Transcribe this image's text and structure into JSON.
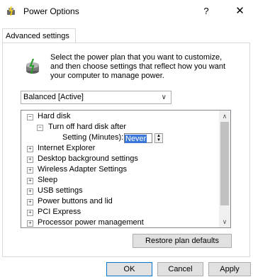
{
  "window": {
    "title": "Power Options",
    "help_label": "?",
    "close_label": "✕"
  },
  "tab": {
    "label": "Advanced settings"
  },
  "intro": {
    "text": "Select the power plan that you want to customize, and then choose settings that reflect how you want your computer to manage power."
  },
  "plan_select": {
    "value": "Balanced [Active]"
  },
  "tree": {
    "items": [
      {
        "label": "Hard disk",
        "state": "expanded"
      },
      {
        "label": "Turn off hard disk after",
        "state": "expanded"
      },
      {
        "label": "Setting (Minutes):",
        "value": "Never"
      },
      {
        "label": "Internet Explorer",
        "state": "collapsed"
      },
      {
        "label": "Desktop background settings",
        "state": "collapsed"
      },
      {
        "label": "Wireless Adapter Settings",
        "state": "collapsed"
      },
      {
        "label": "Sleep",
        "state": "collapsed"
      },
      {
        "label": "USB settings",
        "state": "collapsed"
      },
      {
        "label": "Power buttons and lid",
        "state": "collapsed"
      },
      {
        "label": "PCI Express",
        "state": "collapsed"
      },
      {
        "label": "Processor power management",
        "state": "collapsed"
      }
    ]
  },
  "buttons": {
    "restore": "Restore plan defaults",
    "ok": "OK",
    "cancel": "Cancel",
    "apply": "Apply"
  },
  "colors": {
    "selection": "#3a77d8",
    "ok_border": "#0078d7"
  }
}
